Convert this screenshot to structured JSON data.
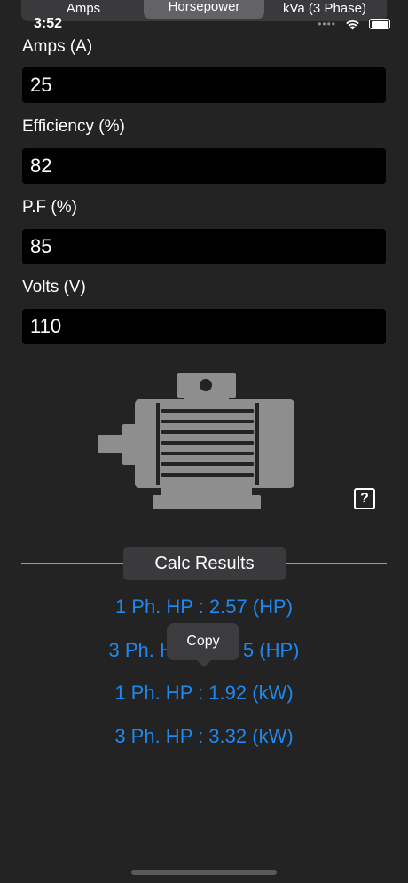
{
  "tabs": [
    {
      "label": "Amps",
      "selected": false
    },
    {
      "label": "Horsepower",
      "selected": true
    },
    {
      "label": "kVa (3 Phase)",
      "selected": false
    }
  ],
  "status": {
    "time": "3:52",
    "icons": [
      "signal-dots-icon",
      "wifi-icon",
      "battery-icon"
    ]
  },
  "fields": [
    {
      "label": "Amps (A)",
      "value": "25"
    },
    {
      "label": "Efficiency (%)",
      "value": "82"
    },
    {
      "label": "P.F (%)",
      "value": "85"
    },
    {
      "label": "Volts (V)",
      "value": "110"
    }
  ],
  "illustration": "electric-motor-icon",
  "help": {
    "label": "?"
  },
  "results": {
    "header": "Calc Results",
    "lines": [
      {
        "prefix": "1 Ph. HP : 2.57 (HP)",
        "suffix": ""
      },
      {
        "prefix": "3 Ph. H",
        "suffix": "5 (HP)"
      },
      {
        "prefix": "1 Ph. HP : 1.92 (kW)",
        "suffix": ""
      },
      {
        "prefix": "3 Ph. HP : 3.32 (kW)",
        "suffix": ""
      }
    ]
  },
  "tooltip": {
    "label": "Copy"
  },
  "colors": {
    "accent": "#1e88f0",
    "background": "#232323",
    "field": "#000000",
    "motor": "#8e8e8e"
  }
}
